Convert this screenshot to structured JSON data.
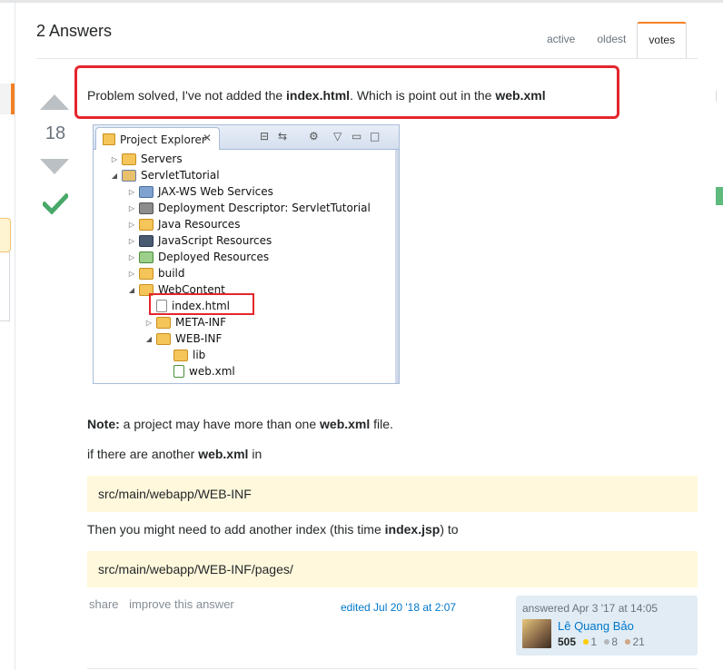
{
  "header": {
    "title": "2 Answers",
    "tabs": [
      {
        "label": "active",
        "active": false
      },
      {
        "label": "oldest",
        "active": false
      },
      {
        "label": "votes",
        "active": true
      }
    ]
  },
  "answer": {
    "vote_count": "18",
    "accepted": true,
    "intro": {
      "prefix": "Problem solved, I've not added the ",
      "file1": "index.html",
      "middle": ". Which is point out in the ",
      "file2": "web.xml"
    },
    "screenshot": {
      "tab_title": "Project Explorer",
      "tree": [
        {
          "label": "Servers",
          "icon": "folder-icon",
          "expanded": false
        },
        {
          "label": "ServletTutorial",
          "icon": "project-icon",
          "expanded": true
        },
        {
          "label": "JAX-WS Web Services",
          "icon": "webservices-icon",
          "expanded": false
        },
        {
          "label": "Deployment Descriptor: ServletTutorial",
          "icon": "descriptor-icon",
          "expanded": false
        },
        {
          "label": "Java Resources",
          "icon": "java-resources-icon",
          "expanded": false
        },
        {
          "label": "JavaScript Resources",
          "icon": "javascript-resources-icon",
          "expanded": false
        },
        {
          "label": "Deployed Resources",
          "icon": "deployed-resources-icon",
          "expanded": false
        },
        {
          "label": "build",
          "icon": "folder-icon",
          "expanded": false
        },
        {
          "label": "WebContent",
          "icon": "folder-icon",
          "expanded": true
        },
        {
          "label": "index.html",
          "icon": "file-icon",
          "expanded": null
        },
        {
          "label": "META-INF",
          "icon": "folder-icon",
          "expanded": false
        },
        {
          "label": "WEB-INF",
          "icon": "folder-icon",
          "expanded": true
        },
        {
          "label": "lib",
          "icon": "folder-icon",
          "expanded": null
        },
        {
          "label": "web.xml",
          "icon": "xml-file-icon",
          "expanded": null
        }
      ]
    },
    "note": {
      "bold": "Note:",
      "text1": " a project may have more than one ",
      "file": "web.xml",
      "text2": " file."
    },
    "if_line": {
      "text": "if there are another ",
      "file": "web.xml",
      "tail": " in"
    },
    "code1": "src/main/webapp/WEB-INF",
    "then_line": {
      "text": "Then you might need to add another index (this time ",
      "file": "index.jsp",
      "tail": ") to"
    },
    "code2": "src/main/webapp/WEB-INF/pages/",
    "menu": {
      "share": "share",
      "improve": "improve this answer"
    },
    "edited": "edited Jul 20 '18 at 2:07",
    "user": {
      "answered": "answered Apr 3 '17 at 14:05",
      "name": "Lê Quang Bảo",
      "reputation": "505",
      "gold": "1",
      "silver": "8",
      "bronze": "21"
    }
  },
  "colors": {
    "accent": "#f48024",
    "link": "#0077cc",
    "highlight_box": "#e4262d",
    "accepted": "#48a868",
    "code_bg": "#fff8dc"
  }
}
